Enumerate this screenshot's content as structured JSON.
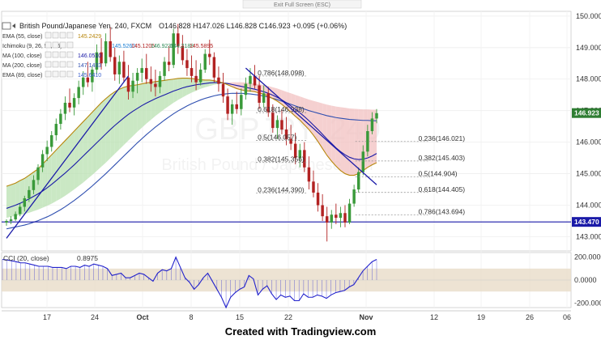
{
  "exit_fullscreen": "Exit Full Screen (ESC)",
  "header": {
    "symbol": "British Pound/Japanese Yen, 240, FXCM",
    "ohlc": "O146.828  H147.026  L146.828  C146.923  +0.095 (+0.06%)",
    "watermark_symbol": "GBPJPY, 240",
    "watermark_name": "British Pound / Japanese Yen"
  },
  "legend": [
    {
      "label": "EMA (55, close)",
      "values": [
        "145.2429"
      ],
      "colors": [
        "#b8860b"
      ]
    },
    {
      "label": "Ichimoku (9, 26, 52, 26)",
      "values": [
        "145.5260",
        "145.1205",
        "146.9239",
        "144.2188",
        "145.5895"
      ],
      "colors": [
        "#1a7fd4",
        "#b22222",
        "#2e8b57",
        "#2e8b57",
        "#b22222"
      ]
    },
    {
      "label": "MA (100, close)",
      "values": [
        "146.0510"
      ],
      "colors": [
        "#1a1aa8"
      ]
    },
    {
      "label": "MA (200, close)",
      "values": [
        "147.1433"
      ],
      "colors": [
        "#2f4fb0"
      ]
    },
    {
      "label": "EMA (89, close)",
      "values": [
        "145.6410"
      ],
      "colors": [
        "#3a5fcd"
      ]
    }
  ],
  "credit": "Created with Tradingview.com",
  "colors": {
    "up": "#3a9a3a",
    "down": "#b22222",
    "ma_dark": "#1a1aa8",
    "ma_light": "#2f4fb0",
    "ema55": "#b8860b",
    "cloud_bull": "#b8e0b0",
    "cloud_bear": "#f2c0c0",
    "cci": "#2222cc",
    "band": "#e8dcc8",
    "support": "#1a1aa8",
    "last_price_bg": "#2e7d32",
    "support_bg": "#1a1aa8"
  },
  "chart_data": [
    {
      "type": "candlestick",
      "price_scale": {
        "ticks": [
          "150.000",
          "149.000",
          "148.000",
          "147.000",
          "146.000",
          "145.000",
          "144.000",
          "143.000"
        ],
        "ylim": [
          142.55,
          150.15
        ]
      },
      "x_ticks": [
        "17",
        "24",
        "Oct",
        "8",
        "15",
        "22",
        "Nov",
        "12",
        "19",
        "26",
        "06"
      ],
      "last_price": "146.923",
      "support_price": "143.470",
      "support_level": 143.47,
      "candles": [
        [
          143.45,
          143.55,
          143.35,
          143.5
        ],
        [
          143.5,
          143.65,
          143.4,
          143.55
        ],
        [
          143.55,
          143.8,
          143.5,
          143.72
        ],
        [
          143.72,
          144.05,
          143.65,
          143.95
        ],
        [
          143.95,
          144.3,
          143.8,
          144.22
        ],
        [
          144.22,
          144.6,
          144.1,
          144.48
        ],
        [
          144.48,
          144.95,
          144.35,
          144.8
        ],
        [
          144.8,
          145.3,
          144.65,
          145.2
        ],
        [
          145.2,
          145.75,
          145.05,
          145.62
        ],
        [
          145.62,
          146.05,
          145.4,
          145.85
        ],
        [
          145.85,
          146.35,
          145.7,
          146.22
        ],
        [
          146.22,
          146.75,
          146.05,
          146.58
        ],
        [
          146.58,
          147.05,
          146.4,
          146.9
        ],
        [
          146.9,
          147.45,
          146.7,
          147.25
        ],
        [
          147.25,
          147.7,
          146.95,
          147.1
        ],
        [
          147.1,
          147.55,
          146.85,
          147.4
        ],
        [
          147.4,
          147.95,
          147.2,
          147.75
        ],
        [
          147.75,
          148.25,
          147.5,
          148.05
        ],
        [
          148.05,
          148.55,
          147.75,
          147.9
        ],
        [
          147.9,
          148.4,
          147.6,
          148.3
        ],
        [
          148.3,
          149.1,
          148.15,
          148.85
        ],
        [
          148.85,
          149.3,
          148.3,
          148.5
        ],
        [
          148.5,
          149.45,
          148.4,
          149.2
        ],
        [
          149.2,
          149.65,
          148.55,
          148.7
        ],
        [
          148.7,
          149.0,
          147.95,
          148.15
        ],
        [
          148.15,
          148.75,
          147.85,
          148.55
        ],
        [
          148.55,
          148.9,
          147.9,
          148.05
        ],
        [
          148.05,
          148.45,
          147.35,
          147.6
        ],
        [
          147.6,
          148.2,
          147.4,
          147.95
        ],
        [
          147.95,
          148.35,
          147.55,
          148.2
        ],
        [
          148.2,
          148.65,
          147.9,
          148.35
        ],
        [
          148.35,
          148.8,
          147.85,
          148.0
        ],
        [
          148.0,
          148.4,
          147.6,
          147.85
        ],
        [
          147.85,
          148.3,
          147.45,
          147.75
        ],
        [
          147.75,
          148.25,
          147.55,
          148.1
        ],
        [
          148.1,
          148.7,
          147.95,
          148.55
        ],
        [
          148.55,
          149.05,
          148.25,
          148.45
        ],
        [
          148.45,
          149.6,
          148.35,
          149.45
        ],
        [
          149.45,
          149.75,
          148.8,
          149.05
        ],
        [
          149.05,
          149.4,
          148.45,
          148.6
        ],
        [
          148.6,
          148.95,
          148.1,
          148.35
        ],
        [
          148.35,
          148.75,
          147.9,
          148.1
        ],
        [
          148.1,
          148.6,
          147.65,
          147.9
        ],
        [
          147.9,
          148.5,
          147.8,
          148.3
        ],
        [
          148.3,
          148.95,
          148.2,
          148.8
        ],
        [
          148.8,
          149.25,
          148.45,
          148.7
        ],
        [
          148.7,
          148.85,
          147.9,
          148.05
        ],
        [
          148.05,
          148.4,
          147.6,
          147.85
        ],
        [
          147.85,
          148.2,
          147.25,
          147.45
        ],
        [
          147.45,
          147.7,
          146.7,
          146.9
        ],
        [
          146.9,
          147.35,
          146.55,
          147.2
        ],
        [
          147.2,
          147.6,
          146.9,
          147.05
        ],
        [
          147.05,
          147.7,
          146.85,
          147.5
        ],
        [
          147.5,
          148.05,
          147.35,
          147.85
        ],
        [
          147.85,
          148.35,
          147.6,
          148.1
        ],
        [
          148.1,
          148.45,
          147.7,
          147.8
        ],
        [
          147.8,
          148.1,
          147.05,
          147.25
        ],
        [
          147.25,
          147.8,
          147.1,
          147.55
        ],
        [
          147.55,
          147.75,
          146.8,
          146.95
        ],
        [
          146.95,
          147.2,
          146.3,
          146.45
        ],
        [
          146.45,
          146.85,
          146.1,
          146.7
        ],
        [
          146.7,
          147.05,
          146.25,
          146.4
        ],
        [
          146.4,
          146.8,
          145.9,
          146.1
        ],
        [
          146.1,
          146.55,
          145.75,
          145.95
        ],
        [
          145.95,
          146.3,
          145.3,
          145.5
        ],
        [
          145.5,
          145.95,
          145.2,
          145.75
        ],
        [
          145.75,
          146.0,
          145.05,
          145.2
        ],
        [
          145.2,
          145.55,
          144.5,
          144.75
        ],
        [
          144.75,
          145.1,
          144.25,
          144.4
        ],
        [
          144.4,
          144.7,
          143.8,
          144.0
        ],
        [
          144.0,
          144.35,
          143.5,
          143.65
        ],
        [
          143.65,
          143.95,
          142.85,
          143.45
        ],
        [
          143.45,
          143.85,
          143.25,
          143.7
        ],
        [
          143.7,
          144.05,
          143.4,
          143.6
        ],
        [
          143.6,
          143.95,
          143.3,
          143.75
        ],
        [
          143.75,
          144.0,
          143.3,
          143.45
        ],
        [
          143.45,
          144.2,
          143.4,
          144.05
        ],
        [
          144.05,
          144.65,
          143.95,
          144.5
        ],
        [
          144.5,
          145.2,
          144.4,
          145.05
        ],
        [
          145.05,
          145.9,
          144.95,
          145.7
        ],
        [
          145.7,
          146.55,
          145.55,
          146.35
        ],
        [
          146.35,
          146.95,
          146.25,
          146.75
        ],
        [
          146.75,
          147.05,
          146.6,
          146.92
        ]
      ],
      "overlays": {
        "ema55": [
          144.6,
          144.65,
          144.7,
          144.78,
          144.85,
          144.95,
          145.05,
          145.15,
          145.3,
          145.45,
          145.6,
          145.75,
          145.9,
          146.05,
          146.2,
          146.35,
          146.5,
          146.65,
          146.8,
          146.95,
          147.1,
          147.25,
          147.38,
          147.5,
          147.6,
          147.68,
          147.74,
          147.78,
          147.8,
          147.82,
          147.85,
          147.88,
          147.9,
          147.92,
          147.94,
          147.96,
          147.98,
          148.0,
          148.02,
          148.03,
          148.03,
          148.02,
          148.0,
          147.98,
          147.97,
          147.97,
          147.95,
          147.92,
          147.88,
          147.82,
          147.76,
          147.7,
          147.66,
          147.63,
          147.62,
          147.6,
          147.56,
          147.52,
          147.46,
          147.38,
          147.3,
          147.2,
          147.08,
          146.95,
          146.82,
          146.7,
          146.55,
          146.4,
          146.22,
          146.02,
          145.8,
          145.58,
          145.4,
          145.24,
          145.1,
          145.0,
          144.95,
          144.95,
          145.0,
          145.1,
          145.2,
          145.28,
          145.35
        ],
        "ema89": [
          143.9,
          143.95,
          144.0,
          144.06,
          144.13,
          144.2,
          144.28,
          144.36,
          144.45,
          144.55,
          144.66,
          144.78,
          144.9,
          145.02,
          145.15,
          145.28,
          145.42,
          145.56,
          145.7,
          145.84,
          145.98,
          146.12,
          146.26,
          146.4,
          146.53,
          146.65,
          146.77,
          146.88,
          146.98,
          147.07,
          147.16,
          147.24,
          147.31,
          147.38,
          147.44,
          147.5,
          147.56,
          147.62,
          147.67,
          147.72,
          147.76,
          147.79,
          147.82,
          147.84,
          147.86,
          147.88,
          147.89,
          147.89,
          147.88,
          147.86,
          147.83,
          147.8,
          147.77,
          147.74,
          147.71,
          147.68,
          147.64,
          147.6,
          147.55,
          147.49,
          147.42,
          147.34,
          147.25,
          147.15,
          147.04,
          146.93,
          146.81,
          146.68,
          146.54,
          146.4,
          146.25,
          146.1,
          145.96,
          145.82,
          145.7,
          145.6,
          145.52,
          145.47,
          145.45,
          145.46,
          145.5,
          145.56,
          145.64
        ],
        "ma100": [
          143.25,
          143.28,
          143.31,
          143.34,
          143.37,
          143.41,
          143.46,
          143.51,
          143.57,
          143.63,
          143.7,
          143.78,
          143.86,
          143.95,
          144.05,
          144.15,
          144.26,
          144.37,
          144.49,
          144.61,
          144.74,
          144.87,
          145.0,
          145.14,
          145.28,
          145.42,
          145.56,
          145.7,
          145.84,
          145.98,
          146.11,
          146.24,
          146.36,
          146.48,
          146.59,
          146.7,
          146.8,
          146.9,
          146.99,
          147.07,
          147.15,
          147.22,
          147.28,
          147.34,
          147.39,
          147.43,
          147.47,
          147.5,
          147.52,
          147.54,
          147.55,
          147.55,
          147.55,
          147.54,
          147.53,
          147.51,
          147.49,
          147.46,
          147.43,
          147.39,
          147.35,
          147.3,
          147.25,
          147.2,
          147.15,
          147.1,
          147.05,
          147.0,
          146.96,
          146.92,
          146.88,
          146.84,
          146.81,
          146.78,
          146.76,
          146.74,
          146.72,
          146.71,
          146.7,
          146.69,
          146.69,
          146.68,
          146.68
        ]
      },
      "trendlines": [
        {
          "from": [
            0,
            142.95
          ],
          "to": [
            27,
            148.1
          ],
          "color": "#1a1aa8"
        },
        {
          "from": [
            53,
            148.35
          ],
          "to": [
            82,
            144.65
          ],
          "color": "#1a1aa8"
        }
      ],
      "fibonacci": [
        {
          "label": "0.786(148.098)",
          "price": 148.098,
          "span": [
            56,
            66
          ]
        },
        {
          "label": "0.618(146.938)",
          "price": 146.938,
          "span": [
            56,
            66
          ]
        },
        {
          "label": "0.5(146.057)",
          "price": 146.057,
          "span": [
            56,
            66
          ]
        },
        {
          "label": "0.382(145.356)",
          "price": 145.356,
          "span": [
            56,
            66
          ]
        },
        {
          "label": "0.236(144.390)",
          "price": 144.39,
          "span": [
            56,
            66
          ]
        },
        {
          "label": "0.236(146.021)",
          "price": 146.021,
          "span": [
            78,
            88
          ]
        },
        {
          "label": "0.382(145.403)",
          "price": 145.403,
          "span": [
            78,
            88
          ]
        },
        {
          "label": "0.5(144.904)",
          "price": 144.904,
          "span": [
            78,
            88
          ]
        },
        {
          "label": "0.618(144.405)",
          "price": 144.405,
          "span": [
            78,
            88
          ]
        },
        {
          "label": "0.786(143.694)",
          "price": 143.694,
          "span": [
            78,
            88
          ]
        }
      ]
    },
    {
      "type": "line",
      "label": "CCI (20, close)",
      "value_label": "0.8975",
      "ticks": [
        "200.0000",
        "0.0000",
        "-200.0000"
      ],
      "ylim": [
        -240,
        240
      ],
      "band": [
        -100,
        100
      ],
      "values": [
        180,
        175,
        168,
        160,
        150,
        150,
        140,
        130,
        120,
        120,
        120,
        110,
        110,
        110,
        100,
        120,
        120,
        110,
        130,
        120,
        140,
        130,
        120,
        100,
        40,
        50,
        60,
        20,
        20,
        40,
        60,
        50,
        20,
        -10,
        60,
        90,
        80,
        100,
        200,
        110,
        20,
        -20,
        -80,
        -40,
        20,
        60,
        -10,
        -80,
        -150,
        -240,
        -150,
        -110,
        -80,
        -60,
        40,
        10,
        -130,
        -80,
        -50,
        -120,
        -170,
        -130,
        -150,
        -140,
        -180,
        -180,
        -120,
        -150,
        -150,
        -130,
        -140,
        -160,
        -130,
        -110,
        -100,
        -90,
        -60,
        -40,
        20,
        80,
        120,
        160,
        180
      ]
    }
  ]
}
